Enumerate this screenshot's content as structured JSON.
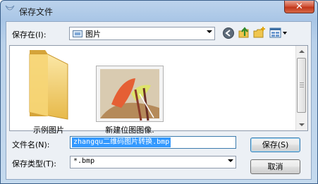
{
  "window": {
    "title": "保存文件"
  },
  "toolbar": {
    "save_in_label": "保存在(I):",
    "save_in_value": "图片",
    "back_icon": "back-arrow-icon",
    "up_icon": "up-folder-icon",
    "new_folder_icon": "new-folder-icon",
    "view_icon": "view-menu-icon"
  },
  "files": [
    {
      "name": "示例图片",
      "type": "folder"
    },
    {
      "name": "新建位图图像.",
      "type": "image"
    }
  ],
  "form": {
    "filename_label": "文件名(N):",
    "filename_value": "zhangqu二维码图片转换.bmp",
    "filetype_label": "保存类型(T):",
    "filetype_value": "*.bmp"
  },
  "buttons": {
    "save": "保存(S)",
    "cancel": "取消"
  },
  "colors": {
    "title_bar": "#b4cde9",
    "close": "#c8402a",
    "selection": "#3399ff"
  }
}
